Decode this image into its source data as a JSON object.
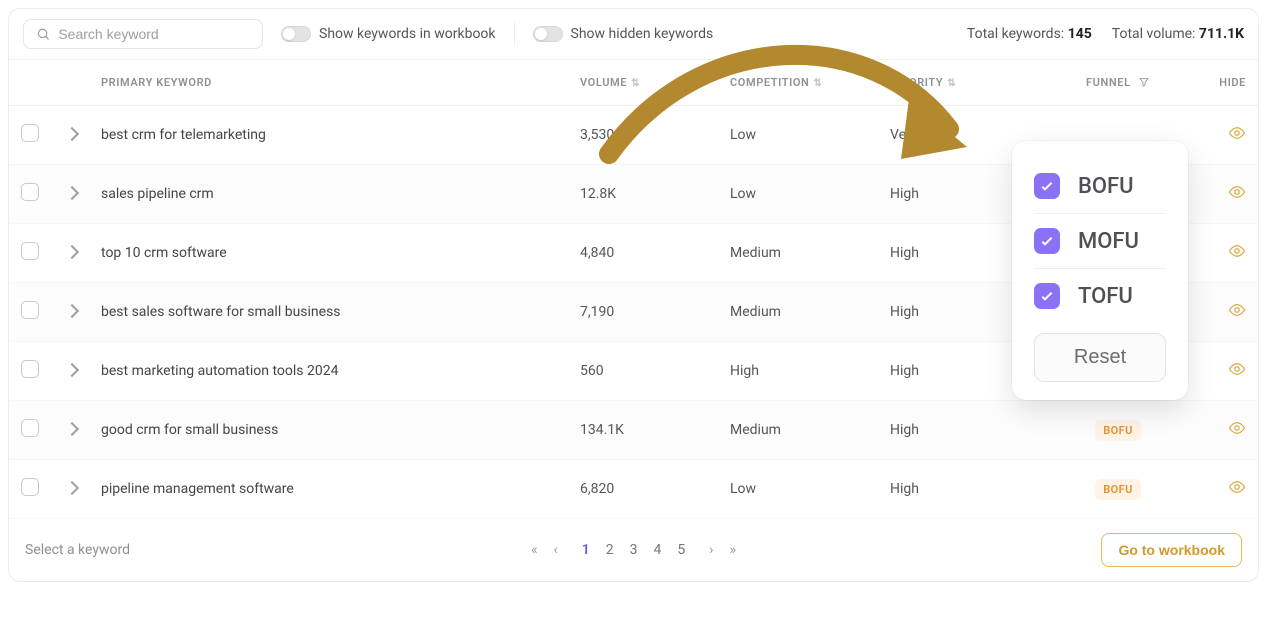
{
  "search": {
    "placeholder": "Search keyword"
  },
  "toggles": {
    "show_in_workbook": "Show keywords in workbook",
    "show_hidden": "Show hidden keywords"
  },
  "stats": {
    "total_keywords_label": "Total keywords:",
    "total_keywords_value": "145",
    "total_volume_label": "Total volume:",
    "total_volume_value": "711.1K"
  },
  "columns": {
    "primary_keyword": "PRIMARY KEYWORD",
    "volume": "VOLUME",
    "competition": "COMPETITION",
    "priority": "PRIORITY",
    "funnel": "FUNNEL",
    "hide": "HIDE"
  },
  "rows": [
    {
      "keyword": "best crm for telemarketing",
      "volume": "3,530",
      "competition": "Low",
      "priority": "Very High",
      "funnel": ""
    },
    {
      "keyword": "sales pipeline crm",
      "volume": "12.8K",
      "competition": "Low",
      "priority": "High",
      "funnel": ""
    },
    {
      "keyword": "top 10 crm software",
      "volume": "4,840",
      "competition": "Medium",
      "priority": "High",
      "funnel": ""
    },
    {
      "keyword": "best sales software for small business",
      "volume": "7,190",
      "competition": "Medium",
      "priority": "High",
      "funnel": ""
    },
    {
      "keyword": "best marketing automation tools 2024",
      "volume": "560",
      "competition": "High",
      "priority": "High",
      "funnel": ""
    },
    {
      "keyword": "good crm for small business",
      "volume": "134.1K",
      "competition": "Medium",
      "priority": "High",
      "funnel": "BOFU"
    },
    {
      "keyword": "pipeline management software",
      "volume": "6,820",
      "competition": "Low",
      "priority": "High",
      "funnel": "BOFU"
    }
  ],
  "footer": {
    "hint": "Select a keyword",
    "pages": [
      "1",
      "2",
      "3",
      "4",
      "5"
    ],
    "active_page_index": 0,
    "go_button": "Go to workbook"
  },
  "filter_popover": {
    "options": [
      "BOFU",
      "MOFU",
      "TOFU"
    ],
    "reset": "Reset"
  },
  "colors": {
    "accent_purple": "#8a71f5",
    "accent_gold": "#b3892f",
    "badge_bg": "#fff3e6",
    "badge_fg": "#e18f2f"
  }
}
